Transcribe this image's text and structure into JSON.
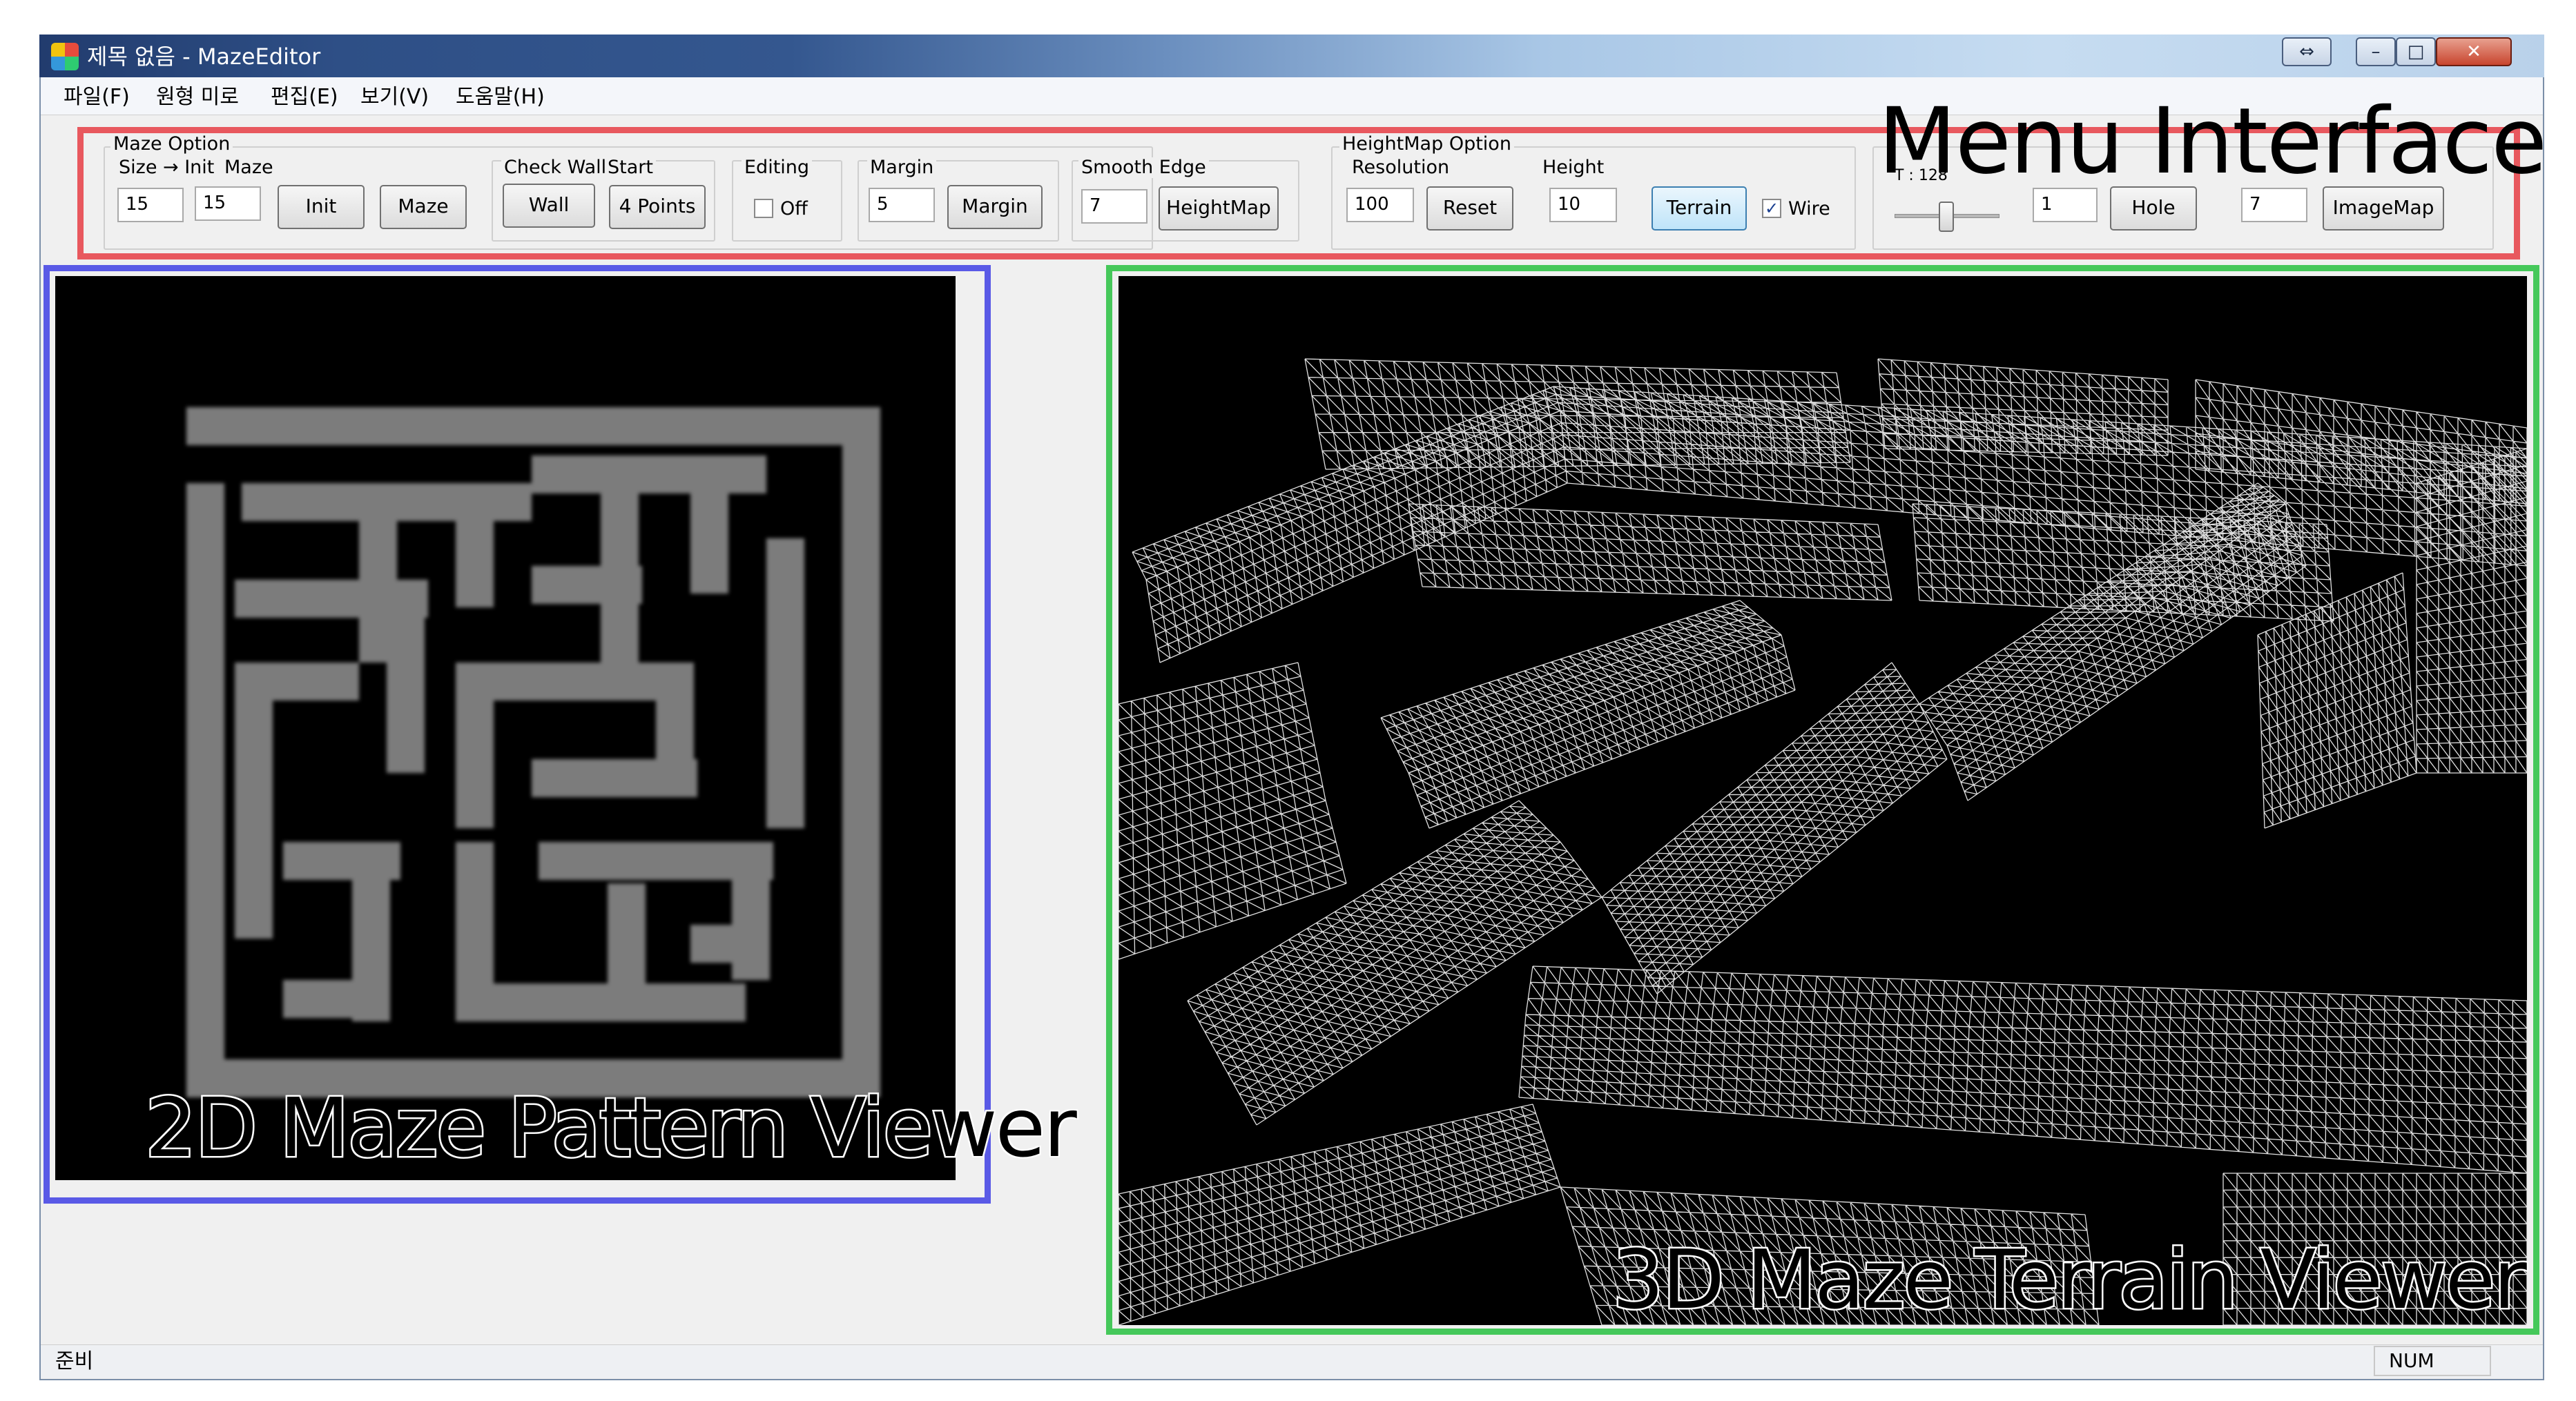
{
  "window": {
    "title": "제목 없음 - MazeEditor",
    "caption_buttons": {
      "resize": "⇔",
      "minimize": "–",
      "maximize": "□",
      "close": "✕"
    }
  },
  "menu": {
    "items": [
      "파일(F)",
      "원형 미로",
      "편집(E)",
      "보기(V)",
      "도움말(H)"
    ]
  },
  "toolbar": {
    "maze_option": {
      "group_label": "Maze Option",
      "size_label": "Size → Init",
      "maze_label": "Maze",
      "size_value": "15",
      "maze_value": "15",
      "init_button": "Init",
      "maze_button": "Maze"
    },
    "check_wall": {
      "label": "Check Wall",
      "button": "Wall"
    },
    "start": {
      "label": "Start",
      "button": "4 Points"
    },
    "editing": {
      "label": "Editing",
      "checkbox_label": "Off",
      "checked": false
    },
    "margin": {
      "label": "Margin",
      "value": "5",
      "button": "Margin"
    },
    "smooth_edge": {
      "label": "Smooth Edge",
      "value": "7",
      "button": "HeightMap"
    },
    "heightmap_option": {
      "group_label": "HeightMap Option",
      "resolution_label": "Resolution",
      "resolution_value": "100",
      "reset_button": "Reset",
      "height_label": "Height",
      "height_value": "10",
      "terrain_button": "Terrain",
      "wire_label": "Wire",
      "wire_checked": true
    },
    "slider": {
      "label": "T : 128",
      "level": 0.5
    },
    "hole": {
      "value": "1",
      "button": "Hole"
    },
    "imagemap": {
      "value": "7",
      "button": "ImageMap"
    }
  },
  "annotations": {
    "menu_interface": "Menu Interface",
    "viewer_2d": "2D Maze Pattern Viewer",
    "viewer_3d": "3D Maze Terrain Viewer",
    "colors": {
      "menu_box": "#e8585e",
      "viewer_2d_box": "#5a5ae6",
      "viewer_3d_box": "#45c85a"
    }
  },
  "maze_2d": {
    "wall_color": "#7b7b7b",
    "background": "#000000"
  },
  "terrain_3d": {
    "wire_color": "#ffffff",
    "background": "#000000"
  },
  "statusbar": {
    "status": "준비",
    "num_indicator": "NUM"
  }
}
